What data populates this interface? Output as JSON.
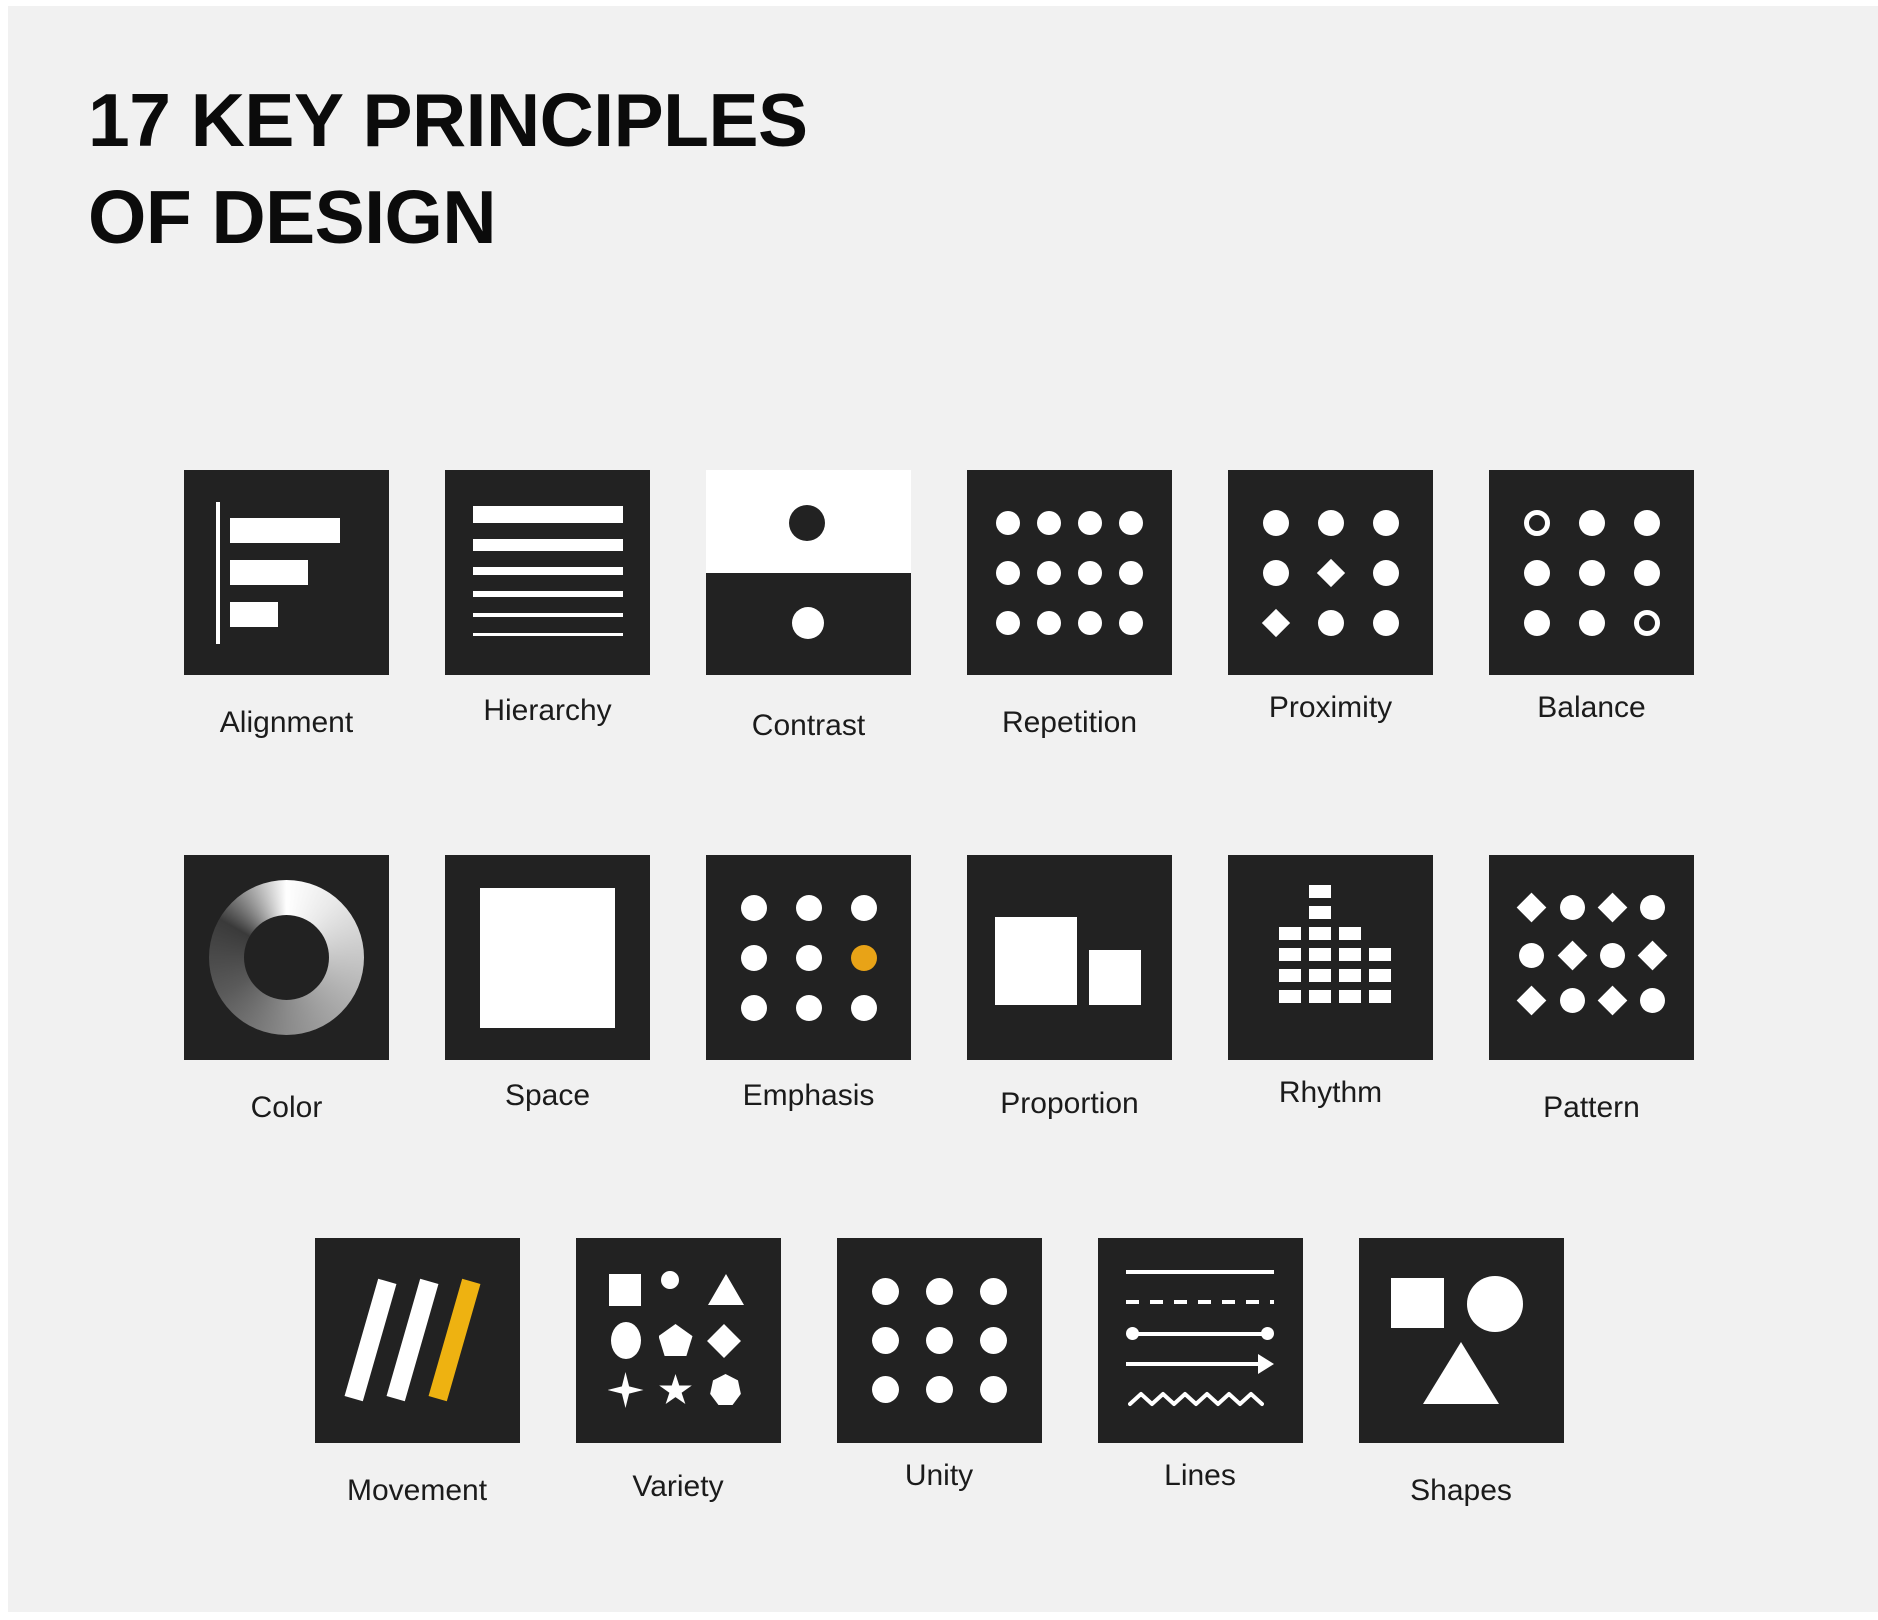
{
  "poster": {
    "background_color": "#f1f1f1",
    "tile_color": "#222222",
    "accent_color": "#e8a317",
    "text_color": "#1b1b1b",
    "title_line_1": "17 KEY PRINCIPLES",
    "title_line_2": "OF DESIGN"
  },
  "rows": [
    {
      "index": 1,
      "items": [
        {
          "label": "Alignment",
          "icon": "alignment-icon"
        },
        {
          "label": "Hierarchy",
          "icon": "hierarchy-icon"
        },
        {
          "label": "Contrast",
          "icon": "contrast-icon"
        },
        {
          "label": "Repetition",
          "icon": "repetition-icon"
        },
        {
          "label": "Proximity",
          "icon": "proximity-icon"
        },
        {
          "label": "Balance",
          "icon": "balance-icon"
        }
      ]
    },
    {
      "index": 2,
      "items": [
        {
          "label": "Color",
          "icon": "color-icon"
        },
        {
          "label": "Space",
          "icon": "space-icon"
        },
        {
          "label": "Emphasis",
          "icon": "emphasis-icon"
        },
        {
          "label": "Proportion",
          "icon": "proportion-icon"
        },
        {
          "label": "Rhythm",
          "icon": "rhythm-icon"
        },
        {
          "label": "Pattern",
          "icon": "pattern-icon"
        }
      ]
    },
    {
      "index": 3,
      "items": [
        {
          "label": "Movement",
          "icon": "movement-icon"
        },
        {
          "label": "Variety",
          "icon": "variety-icon"
        },
        {
          "label": "Unity",
          "icon": "unity-icon"
        },
        {
          "label": "Lines",
          "icon": "lines-icon"
        },
        {
          "label": "Shapes",
          "icon": "shapes-icon"
        }
      ]
    }
  ]
}
